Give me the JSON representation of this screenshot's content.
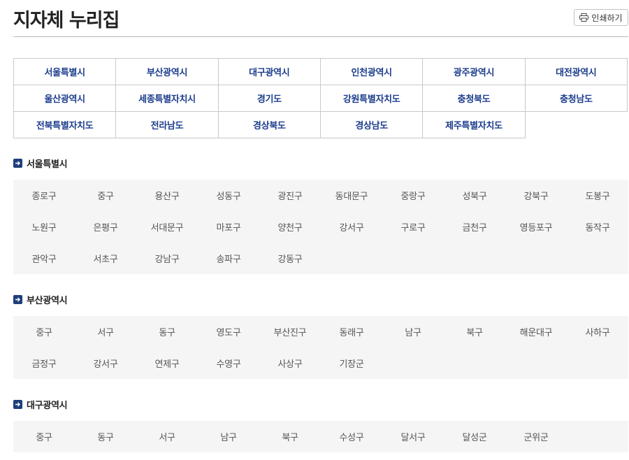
{
  "header": {
    "title": "지자체 누리집",
    "print_label": "인쇄하기"
  },
  "regions": [
    "서울특별시",
    "부산광역시",
    "대구광역시",
    "인천광역시",
    "광주광역시",
    "대전광역시",
    "울산광역시",
    "세종특별자치시",
    "경기도",
    "강원특별자치도",
    "충청북도",
    "충청남도",
    "전북특별자치도",
    "전라남도",
    "경상북도",
    "경상남도",
    "제주특별자치도"
  ],
  "sections": [
    {
      "title": "서울특별시",
      "districts": [
        "종로구",
        "중구",
        "용산구",
        "성동구",
        "광진구",
        "동대문구",
        "중랑구",
        "성북구",
        "강북구",
        "도봉구",
        "노원구",
        "은평구",
        "서대문구",
        "마포구",
        "양천구",
        "강서구",
        "구로구",
        "금천구",
        "영등포구",
        "동작구",
        "관악구",
        "서초구",
        "강남구",
        "송파구",
        "강동구"
      ]
    },
    {
      "title": "부산광역시",
      "districts": [
        "중구",
        "서구",
        "동구",
        "영도구",
        "부산진구",
        "동래구",
        "남구",
        "북구",
        "해운대구",
        "사하구",
        "금정구",
        "강서구",
        "연제구",
        "수영구",
        "사상구",
        "기장군"
      ]
    },
    {
      "title": "대구광역시",
      "districts": [
        "중구",
        "동구",
        "서구",
        "남구",
        "북구",
        "수성구",
        "달서구",
        "달성군",
        "군위군"
      ]
    }
  ],
  "colors": {
    "region_link": "#1c3d8c",
    "section_icon": "#1f3f7a",
    "district_bg": "#f5f5f5"
  }
}
